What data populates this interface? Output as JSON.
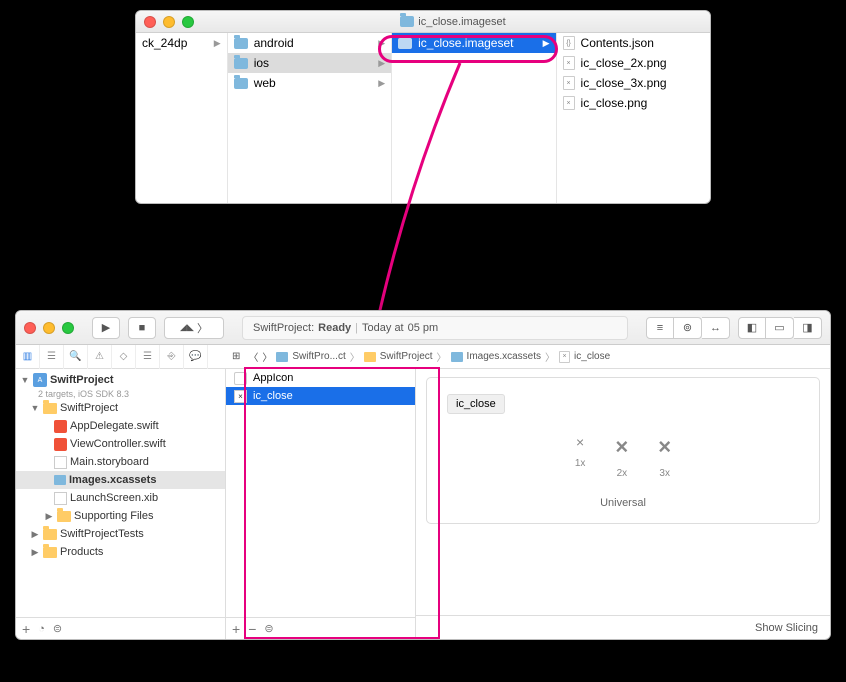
{
  "finder": {
    "title": "ic_close.imageset",
    "columns": [
      {
        "items": [
          {
            "label": "ck_24dp",
            "expand": true
          }
        ]
      },
      {
        "items": [
          {
            "label": "android",
            "type": "folder",
            "expand": true
          },
          {
            "label": "ios",
            "type": "folder",
            "expand": true,
            "selected_parent": true
          },
          {
            "label": "web",
            "type": "folder",
            "expand": true
          }
        ]
      },
      {
        "items": [
          {
            "label": "ic_close.imageset",
            "type": "folder",
            "expand": true,
            "selected": true
          }
        ]
      },
      {
        "items": [
          {
            "label": "Contents.json",
            "type": "file"
          },
          {
            "label": "ic_close_2x.png",
            "type": "file"
          },
          {
            "label": "ic_close_3x.png",
            "type": "file"
          },
          {
            "label": "ic_close.png",
            "type": "file"
          }
        ]
      }
    ]
  },
  "xcode": {
    "status_project": "SwiftProject:",
    "status_state": "Ready",
    "status_time_prefix": "Today at",
    "status_time_suffix": "05 pm",
    "breadcrumbs": [
      "SwiftPro...ct",
      "SwiftProject",
      "Images.xcassets",
      "ic_close"
    ],
    "project_name": "SwiftProject",
    "project_sub": "2 targets, iOS SDK 8.3",
    "tree": {
      "group1": "SwiftProject",
      "files": [
        "AppDelegate.swift",
        "ViewController.swift",
        "Main.storyboard",
        "Images.xcassets",
        "LaunchScreen.xib"
      ],
      "supporting": "Supporting Files",
      "tests": "SwiftProjectTests",
      "products": "Products"
    },
    "assetlist": {
      "items": [
        {
          "label": "AppIcon"
        },
        {
          "label": "ic_close",
          "selected": true
        }
      ]
    },
    "detail": {
      "name": "ic_close",
      "slots": [
        "1x",
        "2x",
        "3x"
      ],
      "universal": "Universal",
      "show_slicing": "Show Slicing"
    }
  }
}
